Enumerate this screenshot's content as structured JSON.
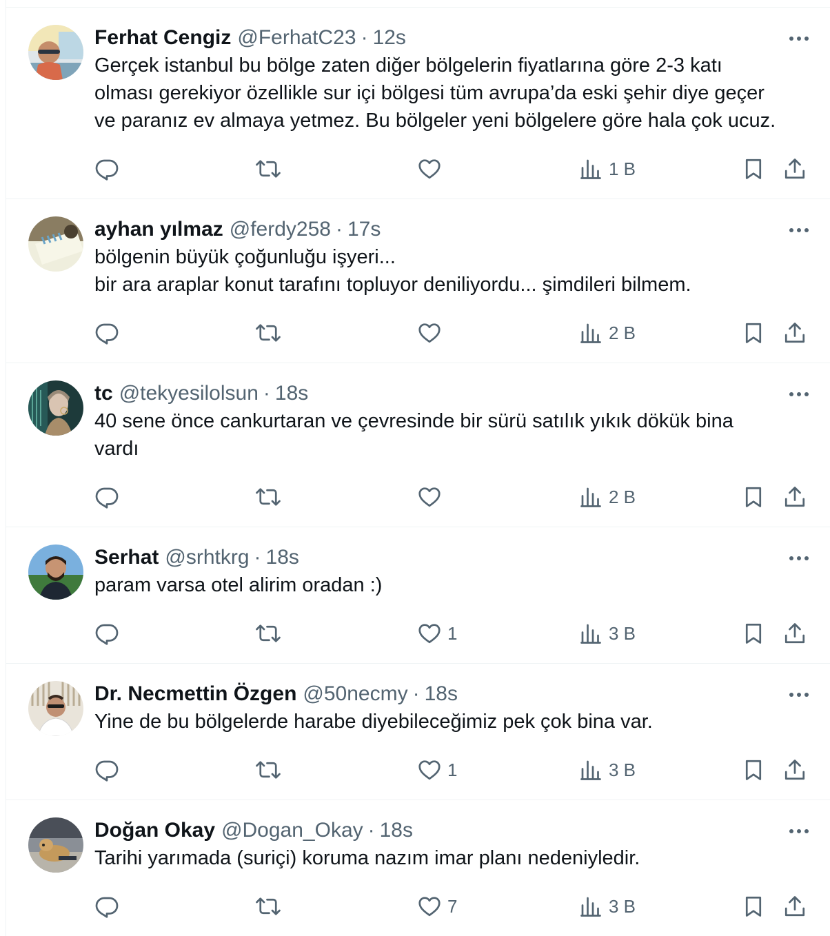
{
  "tweets": [
    {
      "name": "Ferhat Cengiz",
      "handle": "@FerhatC23",
      "dot": "·",
      "time": "12s",
      "text": "Gerçek istanbul bu bölge zaten diğer bölgelerin fiyatlarına göre 2-3 katı\nolması gerekiyor özellikle sur içi bölgesi tüm avrupa’da eski şehir diye geçer\nve paranız ev almaya yetmez. Bu bölgeler yeni bölgelere göre hala çok ucuz.",
      "likes": "",
      "views": "1 B"
    },
    {
      "name": "ayhan yılmaz",
      "handle": "@ferdy258",
      "dot": "·",
      "time": "17s",
      "text": "bölgenin büyük çoğunluğu işyeri...\nbir ara araplar konut tarafını topluyor deniliyordu... şimdileri bilmem.",
      "likes": "",
      "views": "2 B"
    },
    {
      "name": "tc",
      "handle": "@tekyesilolsun",
      "dot": "·",
      "time": "18s",
      "text": "40 sene önce cankurtaran ve çevresinde bir sürü satılık yıkık dökük bina\nvardı",
      "likes": "",
      "views": "2 B"
    },
    {
      "name": "Serhat",
      "handle": "@srhtkrg",
      "dot": "·",
      "time": "18s",
      "text": "param varsa otel alirim oradan :)",
      "likes": "1",
      "views": "3 B"
    },
    {
      "name": "Dr. Necmettin Özgen",
      "handle": "@50necmy",
      "dot": "·",
      "time": "18s",
      "text": "Yine de bu bölgelerde harabe diyebileceğimiz pek çok bina var.",
      "likes": "1",
      "views": "3 B"
    },
    {
      "name": "Doğan Okay",
      "handle": "@Dogan_Okay",
      "dot": "·",
      "time": "18s",
      "text": "Tarihi yarımada (suriçi) koruma nazım imar planı nedeniyledir.",
      "likes": "7",
      "views": "3 B"
    }
  ],
  "icons": {
    "reply": "reply-icon",
    "retweet": "retweet-icon",
    "like": "heart-icon",
    "views": "views-icon",
    "bookmark": "bookmark-icon",
    "share": "share-icon",
    "more": "more-icon"
  },
  "colors": {
    "text_primary": "#0f1419",
    "text_secondary": "#536471",
    "divider": "#eff3f4",
    "background": "#ffffff"
  }
}
